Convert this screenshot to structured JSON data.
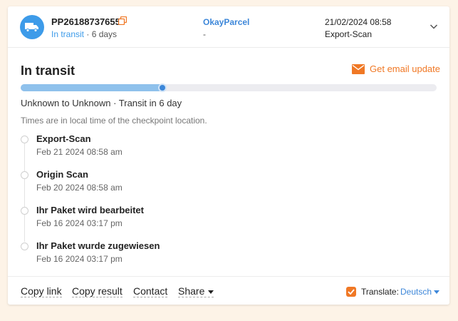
{
  "colors": {
    "accent_blue": "#3d9be9",
    "link_blue": "#3d87d9",
    "accent_orange": "#f07825",
    "page_bg": "#fdf3e7"
  },
  "header": {
    "icon": "truck-icon",
    "tracking_number": "PP26188737655",
    "status": "In transit",
    "status_suffix": " · 6 days",
    "carrier_name": "OkayParcel",
    "carrier_sub": "-",
    "last_update_time": "21/02/2024 08:58",
    "last_event": "Export-Scan"
  },
  "summary": {
    "status_title": "In transit",
    "email_update_label": "Get email update",
    "progress_fraction": 0.34,
    "route": "Unknown to Unknown · Transit in 6 day",
    "times_note": "Times are in local time of the checkpoint location."
  },
  "events": [
    {
      "title": "Export-Scan",
      "time": "Feb 21 2024 08:58 am"
    },
    {
      "title": "Origin Scan",
      "time": "Feb 20 2024 08:58 am"
    },
    {
      "title": "Ihr Paket wird bearbeitet",
      "time": "Feb 16 2024 03:17 pm"
    },
    {
      "title": "Ihr Paket wurde zugewiesen",
      "time": "Feb 16 2024 03:17 pm"
    }
  ],
  "footer": {
    "copy_link": "Copy link",
    "copy_result": "Copy result",
    "contact": "Contact",
    "share": "Share",
    "translate_label": "Translate:",
    "translate_language": "Deutsch",
    "translate_checked": true
  }
}
